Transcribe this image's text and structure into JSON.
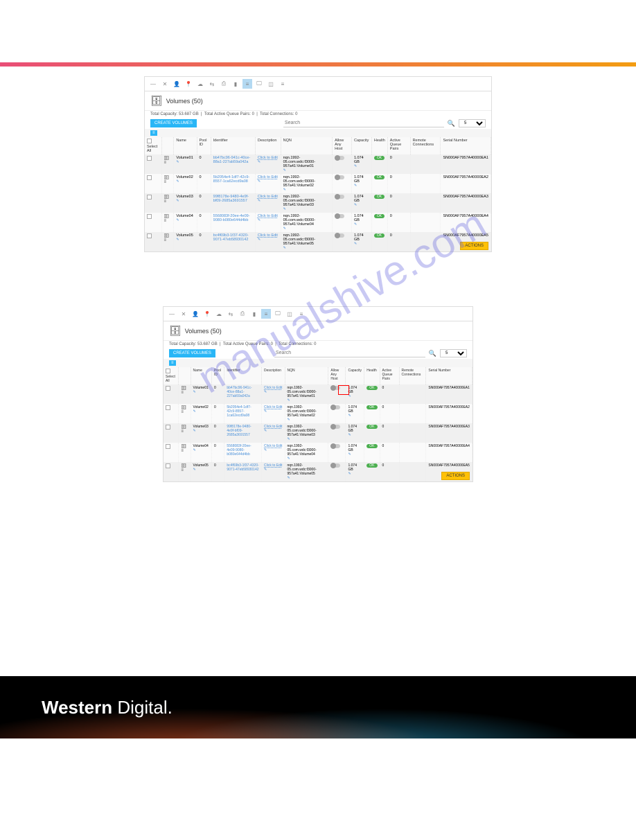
{
  "header": {
    "title": "Volumes (50)"
  },
  "stats": {
    "capacity_label": "Total Capacity:",
    "capacity_value": "53.687 GB",
    "queue_label": "Total Active Queue Pairs:",
    "queue_value": "0",
    "conn_label": "Total Connections:",
    "conn_value": "0"
  },
  "controls": {
    "create_label": "CREATE VOLUMES",
    "search_placeholder": "Search",
    "page_size": "5"
  },
  "columns": {
    "select": "Select All",
    "name": "Name",
    "pool": "Pool ID",
    "identifier": "Identifier",
    "description": "Description",
    "nqn": "NQN",
    "allow": "Allow Any Host",
    "capacity": "Capacity",
    "health": "Health",
    "queue": "Active Queue Pairs",
    "remote": "Remote Connections",
    "serial": "Serial Number"
  },
  "rows": [
    {
      "name": "Volume01",
      "pool": "0",
      "identifier": "bb47bc96-941c-40ce-88a1-227ab59a042a",
      "desc": "Click to Edit",
      "nqn": "nqn.1992-05.com.wdc:f3000-957a41:Volume01",
      "capacity": "1.074 GB",
      "health": "OK",
      "queue": "0",
      "serial": "SN000AF7957A40000EA1"
    },
    {
      "name": "Volume02",
      "pool": "0",
      "identifier": "5b2054e4-1df7-42c9-8557-1ca62ecd9a08",
      "desc": "Click to Edit",
      "nqn": "nqn.1992-05.com.wdc:f3000-957a41:Volume02",
      "capacity": "1.074 GB",
      "health": "OK",
      "queue": "0",
      "serial": "SN000AF7957A40000EA2"
    },
    {
      "name": "Volume03",
      "pool": "0",
      "identifier": "99f8178e-9480-4e9f-bf09-2685a3691557",
      "desc": "Click to Edit",
      "nqn": "nqn.1992-05.com.wdc:f3000-957a41:Volume03",
      "capacity": "1.074 GB",
      "health": "OK",
      "queue": "0",
      "serial": "SN000AF7957A40000EA3"
    },
    {
      "name": "Volume04",
      "pool": "0",
      "identifier": "5568083f-20ee-4e09-9080-b080e644d4bb",
      "desc": "Click to Edit",
      "nqn": "nqn.1992-05.com.wdc:f3000-957a41:Volume04",
      "capacity": "1.074 GB",
      "health": "OK",
      "queue": "0",
      "serial": "SN000AF7957A40000EA4"
    },
    {
      "name": "Volume05",
      "pool": "0",
      "identifier": "bc4f69b3-1f37-4320-9071-47eb58930142",
      "desc": "Click to Edit",
      "nqn": "nqn.1992-05.com.wdc:f3000-957a41:Volume05",
      "capacity": "1.074 GB",
      "health": "OK",
      "queue": "0",
      "serial": "SN000AF7957A40000EA5"
    }
  ],
  "actions_label": "ACTIONS",
  "watermark": "manualshive.com",
  "footer_logo_a": "Western",
  "footer_logo_b": "Digital."
}
